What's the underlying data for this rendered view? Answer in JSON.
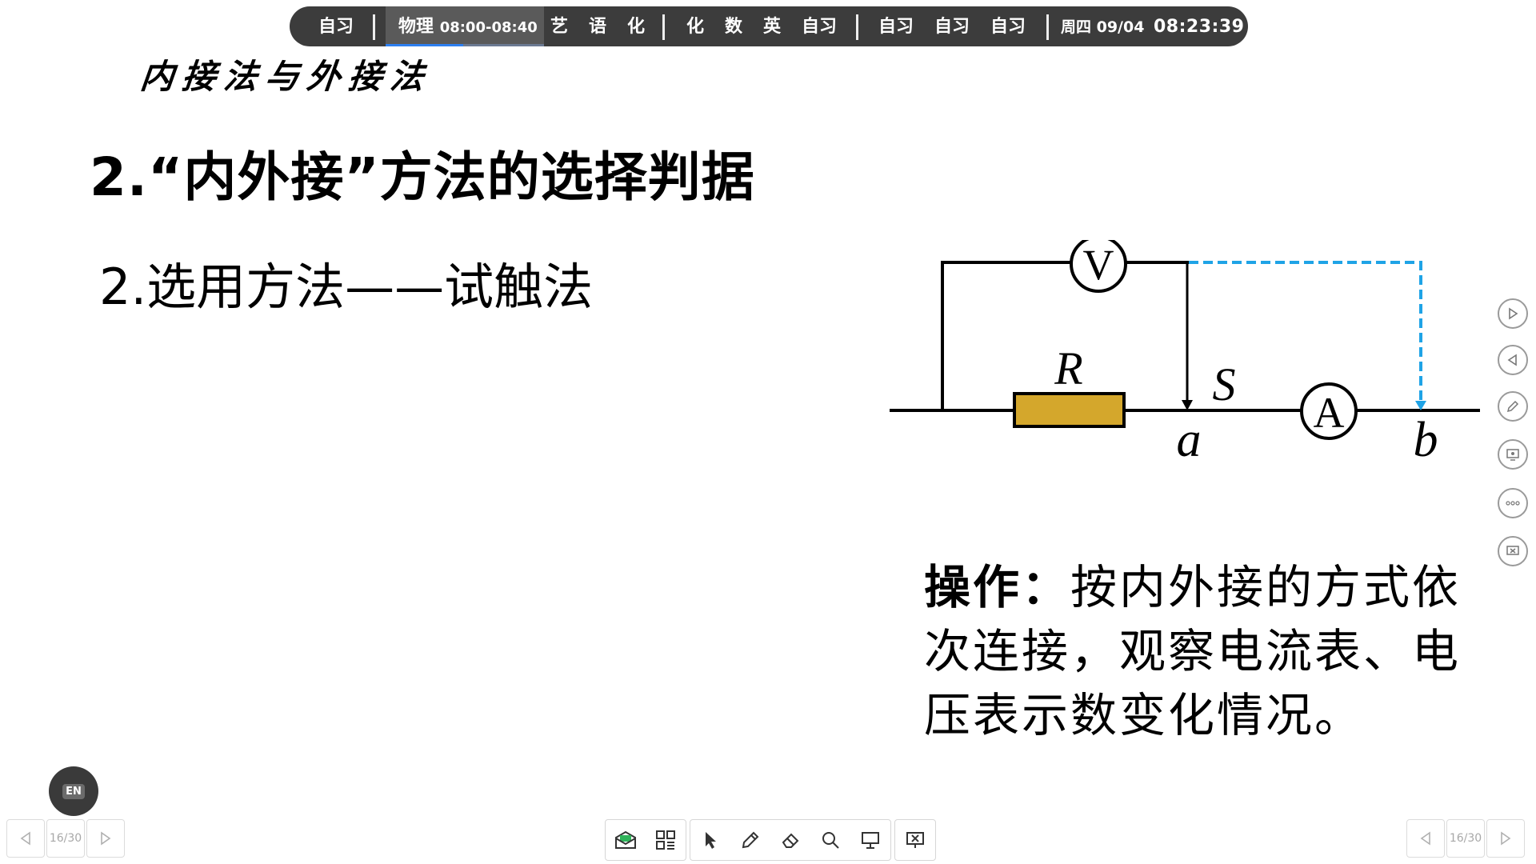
{
  "schedule": {
    "periods": [
      {
        "label": "自习"
      },
      {
        "label": "物理",
        "time": "08:00-08:40",
        "current": true
      },
      {
        "label": "艺"
      },
      {
        "label": "语"
      },
      {
        "label": "化"
      },
      {
        "label": "化"
      },
      {
        "label": "数"
      },
      {
        "label": "英"
      },
      {
        "label": "自习"
      },
      {
        "label": "自习"
      },
      {
        "label": "自习"
      },
      {
        "label": "自习"
      }
    ],
    "current_progress_percent": 49,
    "date": "周四 09/04",
    "clock": "08:23:39",
    "colors": {
      "bar": "#3c3c3c",
      "current": "#5a5a5a",
      "progress": "#2d7ff0"
    }
  },
  "slide": {
    "header_title": "内接法与外接法",
    "title": "2.“内外接”方法的选择判据",
    "subtitle": "2.选用方法——试触法",
    "operation_label": "操作：",
    "operation_text": "按内外接的方式依次连接，观察电流表、电压表示数变化情况。",
    "circuit": {
      "voltmeter_symbol": "V",
      "ammeter_symbol": "A",
      "resistor_label": "R",
      "switch_label": "S",
      "point_a": "a",
      "point_b": "b",
      "colors": {
        "wire": "#000000",
        "resistor": "#d4a72c",
        "dashed": "#1fa3e6"
      }
    }
  },
  "side_tools": [
    {
      "icon": "play-next-icon"
    },
    {
      "icon": "play-previous-icon"
    },
    {
      "icon": "pen-icon"
    },
    {
      "icon": "screen-share-icon"
    },
    {
      "icon": "more-icon"
    },
    {
      "icon": "exit-screen-icon"
    }
  ],
  "language_button": {
    "label": "EN"
  },
  "page_nav_left": {
    "indicator": "16/30"
  },
  "page_nav_right": {
    "indicator": "16/30"
  },
  "bottom_toolbar": [
    {
      "icon": "envelope-icon"
    },
    {
      "icon": "apps-grid-icon"
    },
    {
      "icon": "cursor-icon"
    },
    {
      "icon": "pen-icon"
    },
    {
      "icon": "eraser-icon"
    },
    {
      "icon": "search-icon"
    },
    {
      "icon": "presentation-icon"
    },
    {
      "icon": "close-presentation-icon"
    }
  ]
}
